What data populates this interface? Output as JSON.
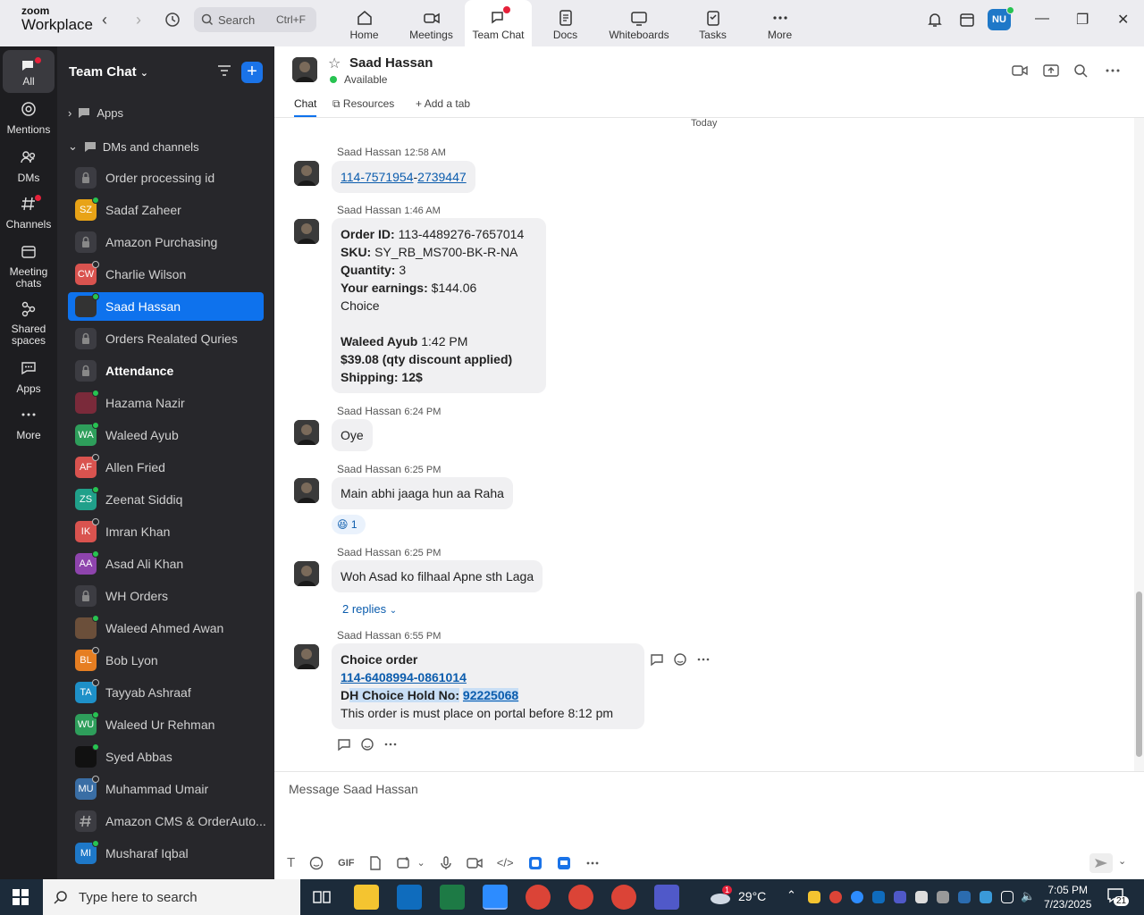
{
  "app": {
    "logo_line1": "zoom",
    "logo_line2": "Workplace"
  },
  "search": {
    "label": "Search",
    "shortcut": "Ctrl+F"
  },
  "top_tabs": [
    {
      "label": "Home"
    },
    {
      "label": "Meetings"
    },
    {
      "label": "Team Chat"
    },
    {
      "label": "Docs"
    },
    {
      "label": "Whiteboards"
    },
    {
      "label": "Tasks"
    },
    {
      "label": "More"
    }
  ],
  "user_avatar": "NU",
  "rail": [
    {
      "label": "All"
    },
    {
      "label": "Mentions"
    },
    {
      "label": "DMs"
    },
    {
      "label": "Channels"
    },
    {
      "label": "Meeting chats"
    },
    {
      "label": "Shared spaces"
    },
    {
      "label": "Apps"
    },
    {
      "label": "More"
    }
  ],
  "sidebar": {
    "title": "Team Chat",
    "sections": [
      {
        "label": "Apps"
      },
      {
        "label": "DMs and channels"
      }
    ],
    "items": [
      {
        "label": "Order processing id",
        "type": "lock"
      },
      {
        "label": "Sadaf Zaheer",
        "initials": "SZ",
        "color": "#e8a317",
        "presence": "on"
      },
      {
        "label": "Amazon Purchasing",
        "type": "lock"
      },
      {
        "label": "Charlie Wilson",
        "initials": "CW",
        "color": "#d9534f",
        "presence": "off"
      },
      {
        "label": "Saad Hassan",
        "initials": "",
        "color": "#333333",
        "presence": "on"
      },
      {
        "label": "Orders Realated Quries",
        "type": "lock"
      },
      {
        "label": "Attendance",
        "type": "lock"
      },
      {
        "label": "Hazama Nazir",
        "initials": "",
        "color": "#7a2a3a",
        "presence": "on"
      },
      {
        "label": "Waleed Ayub",
        "initials": "WA",
        "color": "#2e9e5b",
        "presence": "on"
      },
      {
        "label": "Allen Fried",
        "initials": "AF",
        "color": "#d9534f",
        "presence": "off"
      },
      {
        "label": "Zeenat Siddiq",
        "initials": "ZS",
        "color": "#20a08a",
        "presence": "on"
      },
      {
        "label": "Imran Khan",
        "initials": "IK",
        "color": "#d9534f",
        "presence": "off"
      },
      {
        "label": "Asad Ali Khan",
        "initials": "AA",
        "color": "#8e44ad",
        "presence": "on"
      },
      {
        "label": "WH Orders",
        "type": "lock"
      },
      {
        "label": "Waleed Ahmed Awan",
        "initials": "",
        "color": "#6b4f3a",
        "presence": "on"
      },
      {
        "label": "Bob Lyon",
        "initials": "BL",
        "color": "#e67e22",
        "presence": "off"
      },
      {
        "label": "Tayyab Ashraaf",
        "initials": "TA",
        "color": "#1e90c8",
        "presence": "off"
      },
      {
        "label": "Waleed Ur Rehman",
        "initials": "WU",
        "color": "#2e9e5b",
        "presence": "on"
      },
      {
        "label": "Syed Abbas",
        "initials": "",
        "color": "#111111",
        "presence": "on"
      },
      {
        "label": "Muhammad Umair",
        "initials": "MU",
        "color": "#3a6ea5",
        "presence": "off"
      },
      {
        "label": "Amazon CMS & OrderAuto...",
        "type": "hash"
      },
      {
        "label": "Musharaf Iqbal",
        "initials": "MI",
        "color": "#1e78c8",
        "presence": "on"
      }
    ]
  },
  "chat": {
    "name": "Saad Hassan",
    "status": "Available",
    "tabs": [
      {
        "label": "Chat"
      },
      {
        "label": "Resources"
      },
      {
        "label": "Add a tab"
      }
    ],
    "day_label": "Today",
    "messages": [
      {
        "author": "Saad Hassan",
        "time": "12:58 AM",
        "link_a": "114-7571954",
        "sep": "-",
        "link_b": "2739447"
      },
      {
        "author": "Saad Hassan",
        "time": "1:46 AM",
        "lines": [
          {
            "k": "Order ID:",
            "v": " 113-4489276-7657014"
          },
          {
            "k": "SKU:",
            "v": " SY_RB_MS700-BK-R-NA"
          },
          {
            "k": "Quantity:",
            "v": " 3"
          },
          {
            "k": "Your earnings:",
            "v": " $144.06"
          },
          {
            "k": "",
            "v": "Choice"
          },
          {
            "k": "",
            "v": ""
          },
          {
            "k": "Waleed Ayub",
            "v": " 1:42 PM"
          },
          {
            "k": "$39.08 (qty discount applied)",
            "v": ""
          },
          {
            "k": "Shipping: 12$",
            "v": ""
          }
        ]
      },
      {
        "author": "Saad Hassan",
        "time": "6:24 PM",
        "text": "Oye"
      },
      {
        "author": "Saad Hassan",
        "time": "6:25 PM",
        "text": "Main abhi jaaga hun aa Raha",
        "reaction_count": "1"
      },
      {
        "author": "Saad Hassan",
        "time": "6:25 PM",
        "text": "Woh Asad ko filhaal Apne sth Laga",
        "replies": "2 replies"
      },
      {
        "author": "Saad Hassan",
        "time": "6:55 PM",
        "title": "Choice order",
        "order_link": "114-6408994-0861014",
        "hold_prefix": "D",
        "hold_label": "H Choice Hold No:",
        "hold_link": "92225068",
        "note": "This order is must place on portal before 8:12 pm"
      }
    ]
  },
  "composer": {
    "placeholder": "Message Saad Hassan",
    "gif": "GIF"
  },
  "taskbar": {
    "search_placeholder": "Type here to search",
    "weather_badge": "1",
    "temperature": "29°C",
    "time": "7:05 PM",
    "date": "7/23/2025",
    "notification_count": "21"
  }
}
